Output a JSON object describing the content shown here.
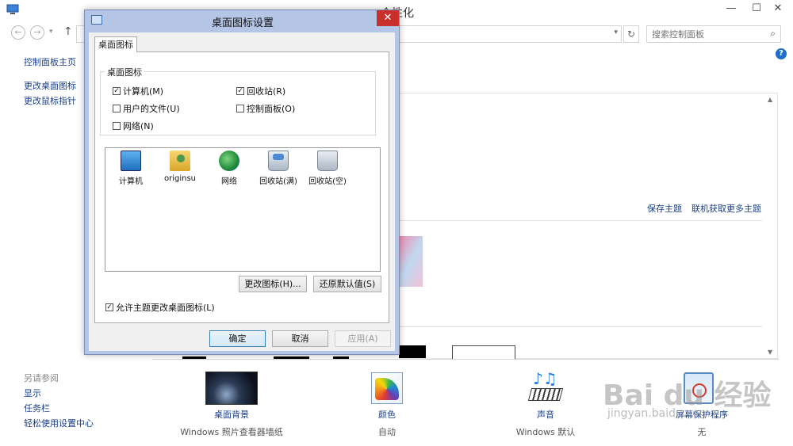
{
  "window": {
    "title": "个性化",
    "min": "—",
    "max": "☐",
    "close": "✕"
  },
  "nav": {
    "back": "←",
    "forward": "→",
    "recent": "▾",
    "up": "↑",
    "address_drop": "▾",
    "refresh": "↻",
    "search_placeholder": "搜索控制面板",
    "search_icon": "⌕"
  },
  "help": "?",
  "sidebar": {
    "items": [
      {
        "label": "控制面板主页"
      },
      {
        "label": "更改桌面图标"
      },
      {
        "label": "更改鼠标指针"
      }
    ],
    "see_also": "另请参阅",
    "see_also_items": [
      {
        "label": "显示"
      },
      {
        "label": "任务栏"
      },
      {
        "label": "轻松使用设置中心"
      }
    ]
  },
  "themes": {
    "save_link": "保存主题",
    "online_link": "联机获取更多主题",
    "scroll_up": "▲",
    "scroll_down": "▼"
  },
  "bottom": [
    {
      "label": "桌面背景",
      "sub": "Windows 照片查看器墙纸"
    },
    {
      "label": "颜色",
      "sub": "自动"
    },
    {
      "label": "声音",
      "sub": "Windows 默认"
    },
    {
      "label": "屏幕保护程序",
      "sub": "无"
    }
  ],
  "watermark": {
    "text": "Bai du 经验",
    "sub": "jingyan.baidu.com"
  },
  "dialog": {
    "title": "桌面图标设置",
    "close": "✕",
    "tab": "桌面图标",
    "group_title": "桌面图标",
    "checkboxes": [
      {
        "label": "计算机(M)",
        "checked": true
      },
      {
        "label": "回收站(R)",
        "checked": true
      },
      {
        "label": "用户的文件(U)",
        "checked": false
      },
      {
        "label": "控制面板(O)",
        "checked": false
      },
      {
        "label": "网络(N)",
        "checked": false
      }
    ],
    "icons": [
      {
        "label": "计算机"
      },
      {
        "label": "originsu"
      },
      {
        "label": "网络"
      },
      {
        "label": "回收站(满)"
      },
      {
        "label": "回收站(空)"
      }
    ],
    "change_icon_btn": "更改图标(H)...",
    "restore_btn": "还原默认值(S)",
    "allow_theme_label": "允许主题更改桌面图标(L)",
    "allow_theme_checked": true,
    "ok_btn": "确定",
    "cancel_btn": "取消",
    "apply_btn": "应用(A)"
  }
}
